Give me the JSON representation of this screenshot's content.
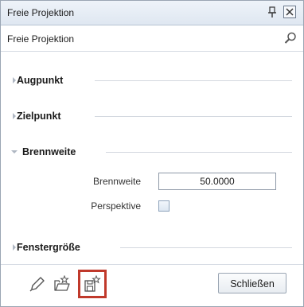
{
  "window": {
    "title": "Freie Projektion"
  },
  "header": {
    "title": "Freie Projektion",
    "search_icon": "search-icon"
  },
  "sections": [
    {
      "label": "Augpunkt",
      "expanded": false
    },
    {
      "label": "Zielpunkt",
      "expanded": false
    },
    {
      "label": "Brennweite",
      "expanded": true
    },
    {
      "label": "Fenstergröße",
      "expanded": false
    }
  ],
  "brennweite": {
    "field_label": "Brennweite",
    "value": "50.0000",
    "perspective_label": "Perspektive",
    "perspective_checked": false
  },
  "footer": {
    "tools": [
      "eyedropper-icon",
      "open-folder-star-icon",
      "save-star-icon"
    ],
    "close_label": "Schließen"
  },
  "colors": {
    "highlight": "#c0392b",
    "titlebar": "#dfe7f1"
  }
}
